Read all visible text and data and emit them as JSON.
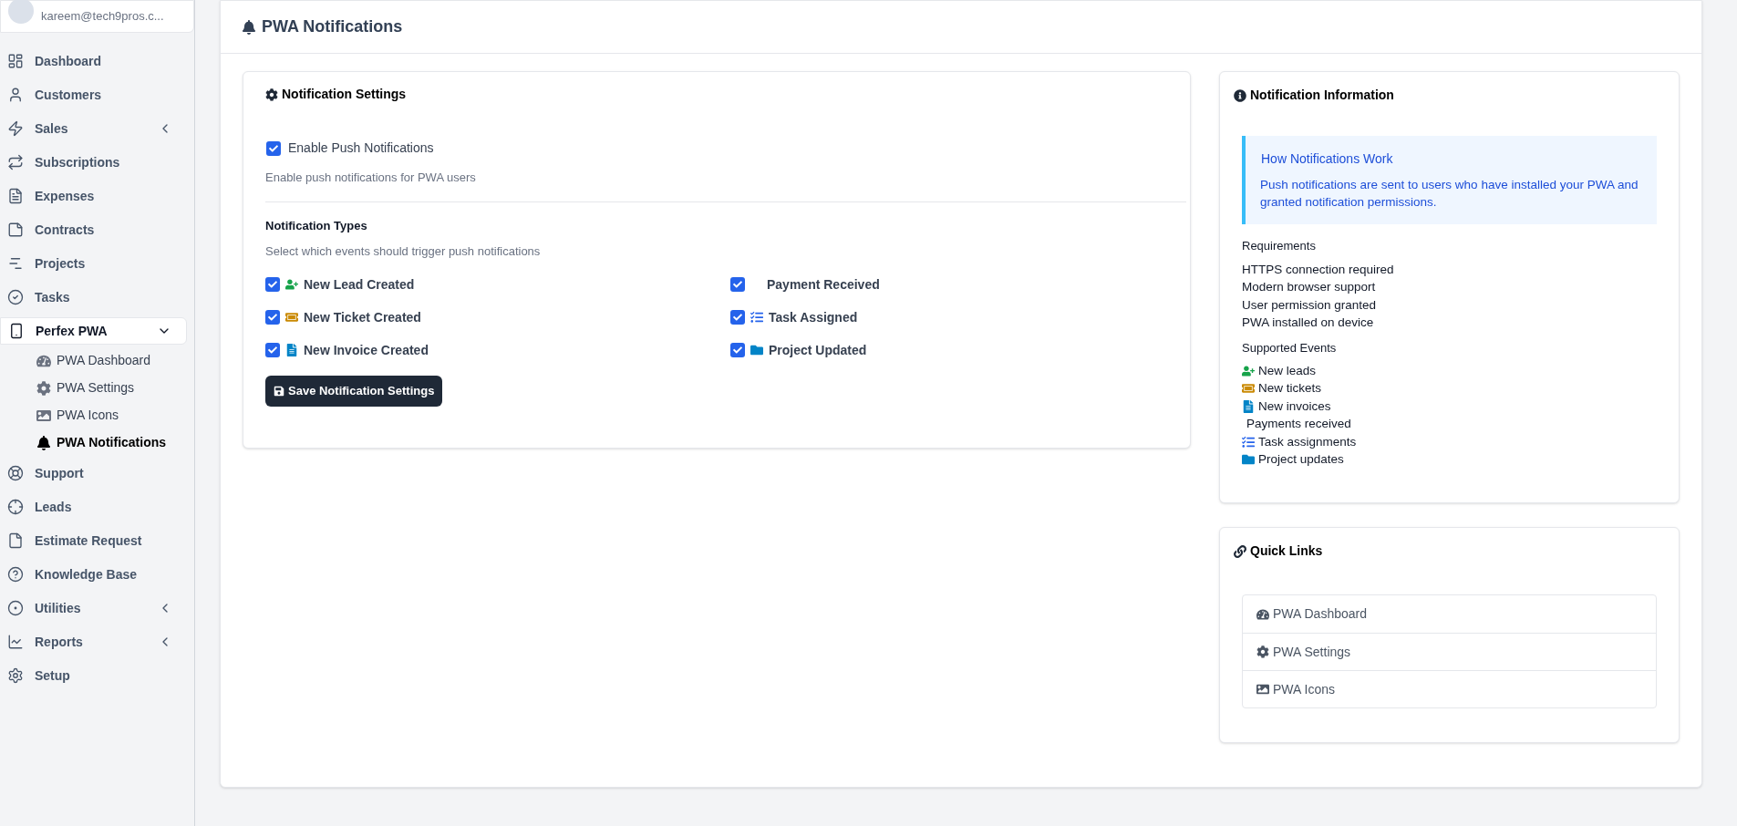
{
  "user": {
    "email": "kareem@tech9pros.c..."
  },
  "sidebar": {
    "items": [
      {
        "label": "Dashboard",
        "selected": false
      },
      {
        "label": "Customers",
        "selected": false
      },
      {
        "label": "Sales",
        "selected": false,
        "expanded": false
      },
      {
        "label": "Subscriptions",
        "selected": false
      },
      {
        "label": "Expenses",
        "selected": false
      },
      {
        "label": "Contracts",
        "selected": false
      },
      {
        "label": "Projects",
        "selected": false
      },
      {
        "label": "Tasks",
        "selected": false
      },
      {
        "label": "Perfex PWA",
        "selected": true,
        "expanded": true,
        "children": [
          {
            "label": "PWA Dashboard",
            "selected": false
          },
          {
            "label": "PWA Settings",
            "selected": false
          },
          {
            "label": "PWA Icons",
            "selected": false
          },
          {
            "label": "PWA Notifications",
            "selected": true
          }
        ]
      },
      {
        "label": "Support",
        "selected": false
      },
      {
        "label": "Leads",
        "selected": false
      },
      {
        "label": "Estimate Request",
        "selected": false
      },
      {
        "label": "Knowledge Base",
        "selected": false
      },
      {
        "label": "Utilities",
        "selected": false,
        "expanded": false
      },
      {
        "label": "Reports",
        "selected": false,
        "expanded": false
      },
      {
        "label": "Setup",
        "selected": false
      }
    ]
  },
  "page": {
    "title": "PWA Notifications"
  },
  "settings": {
    "title": "Notification Settings",
    "enable": {
      "label": "Enable Push Notifications",
      "checked": true,
      "help": "Enable push notifications for PWA users"
    },
    "types_title": "Notification Types",
    "types_help": "Select which events should trigger push notifications",
    "types": [
      {
        "label": "New Lead Created",
        "checked": true
      },
      {
        "label": "Payment Received",
        "checked": true
      },
      {
        "label": "New Ticket Created",
        "checked": true
      },
      {
        "label": "Task Assigned",
        "checked": true
      },
      {
        "label": "New Invoice Created",
        "checked": true
      },
      {
        "label": "Project Updated",
        "checked": true
      }
    ],
    "save_button": "Save Notification Settings"
  },
  "info": {
    "title": "Notification Information",
    "alert_title": "How Notifications Work",
    "alert_text": "Push notifications are sent to users who have installed your PWA and granted notification permissions.",
    "requirements_title": "Requirements",
    "requirements": [
      "HTTPS connection required",
      "Modern browser support",
      "User permission granted",
      "PWA installed on device"
    ],
    "events_title": "Supported Events",
    "events": [
      "New leads",
      "New tickets",
      "New invoices",
      "Payments received",
      "Task assignments",
      "Project updates"
    ]
  },
  "quick_links": {
    "title": "Quick Links",
    "links": [
      "PWA Dashboard",
      "PWA Settings",
      "PWA Icons"
    ]
  }
}
